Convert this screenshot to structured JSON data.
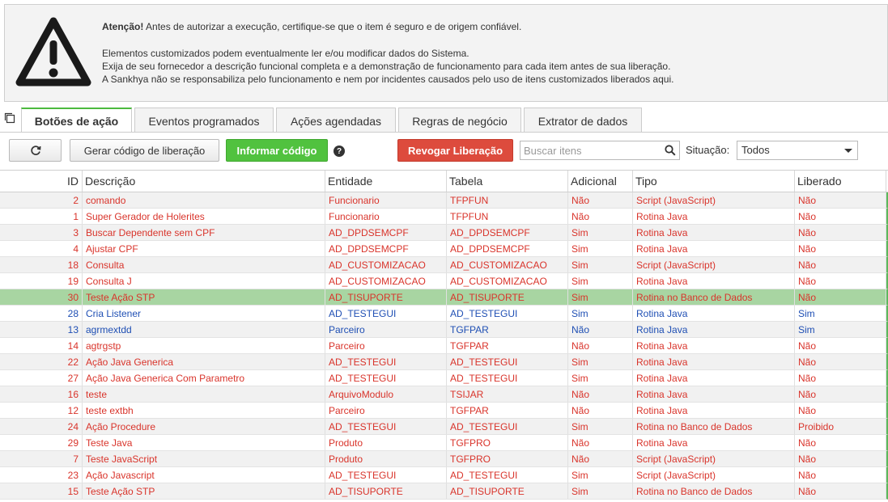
{
  "warning": {
    "lead": "Atenção!",
    "line1": " Antes de autorizar a execução, certifique-se que o item é seguro e de origem confiável.",
    "line2": "Elementos customizados podem eventualmente ler e/ou modificar dados do Sistema.",
    "line3": "Exija de seu fornecedor a descrição funcional completa e a demonstração de funcionamento para cada item antes de sua liberação.",
    "line4": "A Sankhya não se responsabiliza pelo funcionamento e nem por incidentes causados pelo uso de itens customizados liberados aqui."
  },
  "tabs": [
    {
      "label": "Botões de ação"
    },
    {
      "label": "Eventos programados"
    },
    {
      "label": "Ações agendadas"
    },
    {
      "label": "Regras de negócio"
    },
    {
      "label": "Extrator de dados"
    }
  ],
  "toolbar": {
    "refresh_icon": "refresh-icon",
    "gen_code": "Gerar código de liberação",
    "inform_code": "Informar código",
    "help": "?",
    "revoke": "Revogar Liberação",
    "search_placeholder": "Buscar itens",
    "status_label": "Situação:",
    "status_value": "Todos"
  },
  "colors": {
    "red_text": "#d9342b",
    "blue_text": "#1f4fb4",
    "green_accent": "#51c23f",
    "revoke_red": "#dd4b3d",
    "selected_row": "#a8d5a2"
  },
  "columns": {
    "id": "ID",
    "desc": "Descrição",
    "entity": "Entidade",
    "table": "Tabela",
    "additional": "Adicional",
    "type": "Tipo",
    "released": "Liberado"
  },
  "rows": [
    {
      "id": "2",
      "desc": "comando",
      "entity": "Funcionario",
      "table": "TFPFUN",
      "additional": "Não",
      "type": "Script (JavaScript)",
      "released": "Não",
      "color": "red"
    },
    {
      "id": "1",
      "desc": "Super Gerador de Holerites",
      "entity": "Funcionario",
      "table": "TFPFUN",
      "additional": "Não",
      "type": "Rotina Java",
      "released": "Não",
      "color": "red"
    },
    {
      "id": "3",
      "desc": "Buscar Dependente sem CPF",
      "entity": "AD_DPDSEMCPF",
      "table": "AD_DPDSEMCPF",
      "additional": "Sim",
      "type": "Rotina Java",
      "released": "Não",
      "color": "red"
    },
    {
      "id": "4",
      "desc": "Ajustar CPF",
      "entity": "AD_DPDSEMCPF",
      "table": "AD_DPDSEMCPF",
      "additional": "Sim",
      "type": "Rotina Java",
      "released": "Não",
      "color": "red"
    },
    {
      "id": "18",
      "desc": "Consulta",
      "entity": "AD_CUSTOMIZACAO",
      "table": "AD_CUSTOMIZACAO",
      "additional": "Sim",
      "type": "Script (JavaScript)",
      "released": "Não",
      "color": "red"
    },
    {
      "id": "19",
      "desc": "Consulta J",
      "entity": "AD_CUSTOMIZACAO",
      "table": "AD_CUSTOMIZACAO",
      "additional": "Sim",
      "type": "Rotina Java",
      "released": "Não",
      "color": "red"
    },
    {
      "id": "30",
      "desc": "Teste Ação STP",
      "entity": "AD_TISUPORTE",
      "table": "AD_TISUPORTE",
      "additional": "Sim",
      "type": "Rotina no Banco de Dados",
      "released": "Não",
      "color": "red",
      "selected": true
    },
    {
      "id": "28",
      "desc": "Cria Listener",
      "entity": "AD_TESTEGUI",
      "table": "AD_TESTEGUI",
      "additional": "Sim",
      "type": "Rotina Java",
      "released": "Sim",
      "color": "blue"
    },
    {
      "id": "13",
      "desc": "agrmextdd",
      "entity": "Parceiro",
      "table": "TGFPAR",
      "additional": "Não",
      "type": "Rotina Java",
      "released": "Sim",
      "color": "blue"
    },
    {
      "id": "14",
      "desc": "agtrgstp",
      "entity": "Parceiro",
      "table": "TGFPAR",
      "additional": "Não",
      "type": "Rotina Java",
      "released": "Não",
      "color": "red"
    },
    {
      "id": "22",
      "desc": "Ação Java Generica",
      "entity": "AD_TESTEGUI",
      "table": "AD_TESTEGUI",
      "additional": "Sim",
      "type": "Rotina Java",
      "released": "Não",
      "color": "red"
    },
    {
      "id": "27",
      "desc": "Ação Java Generica Com Parametro",
      "entity": "AD_TESTEGUI",
      "table": "AD_TESTEGUI",
      "additional": "Sim",
      "type": "Rotina Java",
      "released": "Não",
      "color": "red"
    },
    {
      "id": "16",
      "desc": "teste",
      "entity": "ArquivoModulo",
      "table": "TSIJAR",
      "additional": "Não",
      "type": "Rotina Java",
      "released": "Não",
      "color": "red"
    },
    {
      "id": "12",
      "desc": "teste extbh",
      "entity": "Parceiro",
      "table": "TGFPAR",
      "additional": "Não",
      "type": "Rotina Java",
      "released": "Não",
      "color": "red"
    },
    {
      "id": "24",
      "desc": "Ação Procedure",
      "entity": "AD_TESTEGUI",
      "table": "AD_TESTEGUI",
      "additional": "Sim",
      "type": "Rotina no Banco de Dados",
      "released": "Proibido",
      "color": "red"
    },
    {
      "id": "29",
      "desc": "Teste Java",
      "entity": "Produto",
      "table": "TGFPRO",
      "additional": "Não",
      "type": "Rotina Java",
      "released": "Não",
      "color": "red"
    },
    {
      "id": "7",
      "desc": "Teste JavaScript",
      "entity": "Produto",
      "table": "TGFPRO",
      "additional": "Não",
      "type": "Script (JavaScript)",
      "released": "Não",
      "color": "red"
    },
    {
      "id": "23",
      "desc": "Ação Javascript",
      "entity": "AD_TESTEGUI",
      "table": "AD_TESTEGUI",
      "additional": "Sim",
      "type": "Script (JavaScript)",
      "released": "Não",
      "color": "red"
    },
    {
      "id": "15",
      "desc": "Teste Ação STP",
      "entity": "AD_TISUPORTE",
      "table": "AD_TISUPORTE",
      "additional": "Sim",
      "type": "Rotina no Banco de Dados",
      "released": "Não",
      "color": "red"
    }
  ]
}
